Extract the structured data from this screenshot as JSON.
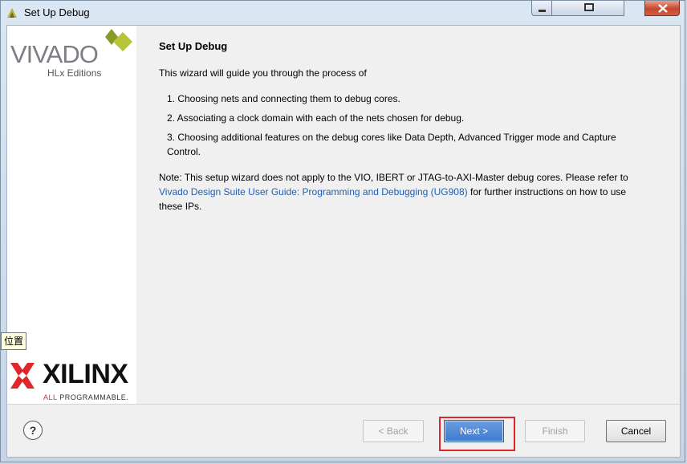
{
  "window": {
    "title": "Set Up Debug"
  },
  "sidebar": {
    "brand": "VIVADO",
    "edition": "HLx Editions",
    "vendor": "XILINX",
    "tagline_prefix": "ALL ",
    "tagline_rest": "PROGRAMMABLE."
  },
  "tooltip": {
    "text": "位置"
  },
  "main": {
    "heading": "Set Up Debug",
    "intro": "This wizard will guide you through the process of",
    "steps": [
      "1.  Choosing nets and connecting them to debug cores.",
      "2.  Associating a clock domain with each of the nets chosen for debug.",
      "3.  Choosing additional features on the debug cores like Data Depth, Advanced Trigger mode and Capture Control."
    ],
    "note_prefix": "Note: This setup wizard does not apply to the VIO, IBERT or JTAG-to-AXI-Master debug cores. Please refer to",
    "note_link": "Vivado Design Suite User Guide: Programming and Debugging (UG908)",
    "note_suffix": " for further instructions on how to use these IPs."
  },
  "footer": {
    "help_label": "?",
    "back_label": "< Back",
    "next_label": "Next >",
    "finish_label": "Finish",
    "cancel_label": "Cancel"
  },
  "colors": {
    "link": "#1f5fb6",
    "highlight_outline": "#e0262b",
    "primary_button": "#4a82d4"
  }
}
